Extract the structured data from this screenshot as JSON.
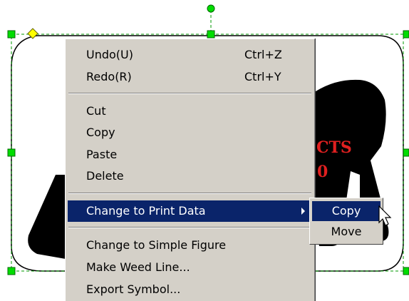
{
  "context_menu": {
    "items": [
      {
        "label": "Undo(U)",
        "shortcut": "Ctrl+Z"
      },
      {
        "label": "Redo(R)",
        "shortcut": "Ctrl+Y"
      },
      {
        "label": "Cut"
      },
      {
        "label": "Copy"
      },
      {
        "label": "Paste"
      },
      {
        "label": "Delete"
      },
      {
        "label": "Change to Print Data",
        "has_submenu": true,
        "highlighted": true
      },
      {
        "label": "Change to Simple Figure"
      },
      {
        "label": "Make Weed Line..."
      },
      {
        "label": "Export Symbol..."
      }
    ]
  },
  "submenu": {
    "items": [
      {
        "label": "Copy",
        "highlighted": true
      },
      {
        "label": "Move"
      }
    ]
  },
  "artwork": {
    "text_fragments": [
      "CTS",
      "0"
    ],
    "text_color": "#e02020",
    "fill_color": "#000000"
  },
  "colors": {
    "menu_bg": "#d4d0c8",
    "highlight_bg": "#0a246a",
    "selection_handle": "#00cc00",
    "rotation_handle": "#ffff00"
  }
}
